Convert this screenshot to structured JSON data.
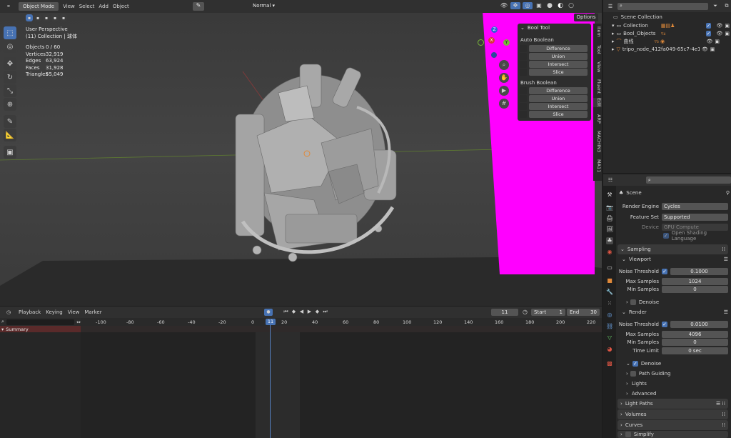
{
  "viewport_header": {
    "mode": "Object Mode",
    "menus": [
      "View",
      "Select",
      "Add",
      "Object"
    ],
    "shading_orientation": "Normal",
    "options_label": "Options"
  },
  "overlay": {
    "perspective": "User Perspective",
    "collection": "(11) Collection | 球体",
    "stats": [
      {
        "label": "Objects",
        "value": "0 / 60"
      },
      {
        "label": "Vertices",
        "value": "32,919"
      },
      {
        "label": "Edges",
        "value": "63,924"
      },
      {
        "label": "Faces",
        "value": "31,928"
      },
      {
        "label": "Triangles",
        "value": "55,049"
      }
    ]
  },
  "bool_tool": {
    "title": "Bool Tool",
    "auto_label": "Auto Boolean",
    "auto_buttons": [
      "Difference",
      "Union",
      "Intersect",
      "Slice"
    ],
    "brush_label": "Brush Boolean",
    "brush_buttons": [
      "Difference",
      "Union",
      "Intersect",
      "Slice"
    ]
  },
  "sidebar_tabs": [
    "Item",
    "Tool",
    "View",
    "Fluent",
    "Edit",
    "ARP",
    "MACHIN3",
    "MA11"
  ],
  "gizmo_axes": {
    "z": "Z",
    "x": "X",
    "y": "Y"
  },
  "outliner": {
    "root": "Scene Collection",
    "items": [
      {
        "label": "Collection",
        "indent": 1
      },
      {
        "label": "Bool_Objects",
        "indent": 1
      },
      {
        "label": "曲线",
        "indent": 1
      },
      {
        "label": "tripo_node_412fa049-65c7-4e13-8",
        "indent": 1
      }
    ]
  },
  "properties": {
    "scene_label": "Scene",
    "render_engine_label": "Render Engine",
    "render_engine_value": "Cycles",
    "feature_set_label": "Feature Set",
    "feature_set_value": "Supported",
    "device_label": "Device",
    "device_value": "GPU Compute",
    "osl_label": "Open Shading Language",
    "sampling": "Sampling",
    "viewport": "Viewport",
    "noise_threshold_label": "Noise Threshold",
    "viewport_noise_threshold": "0.1000",
    "max_samples_label": "Max Samples",
    "viewport_max_samples": "1024",
    "min_samples_label": "Min Samples",
    "viewport_min_samples": "0",
    "denoise_label": "Denoise",
    "render": "Render",
    "render_noise_threshold": "0.0100",
    "render_max_samples": "4096",
    "render_min_samples": "0",
    "time_limit_label": "Time Limit",
    "time_limit_value": "0 sec",
    "path_guiding": "Path Guiding",
    "lights": "Lights",
    "advanced": "Advanced",
    "light_paths": "Light Paths",
    "volumes": "Volumes",
    "curves": "Curves",
    "simplify": "Simplify"
  },
  "timeline": {
    "menus": [
      "Playback",
      "Keying",
      "View",
      "Marker"
    ],
    "current_frame": "11",
    "start_label": "Start",
    "start_value": "1",
    "end_label": "End",
    "end_value": "30",
    "summary_label": "Summary",
    "ruler": [
      "-100",
      "-80",
      "-60",
      "-40",
      "-20",
      "0",
      "11",
      "20",
      "40",
      "60",
      "80",
      "100",
      "120",
      "140",
      "160",
      "180",
      "200",
      "220"
    ]
  },
  "colors": {
    "accent": "#4772b3",
    "magenta": "#ff00ff",
    "playhead": "#5680c2",
    "viewport_bg": "#3d3d3d"
  }
}
